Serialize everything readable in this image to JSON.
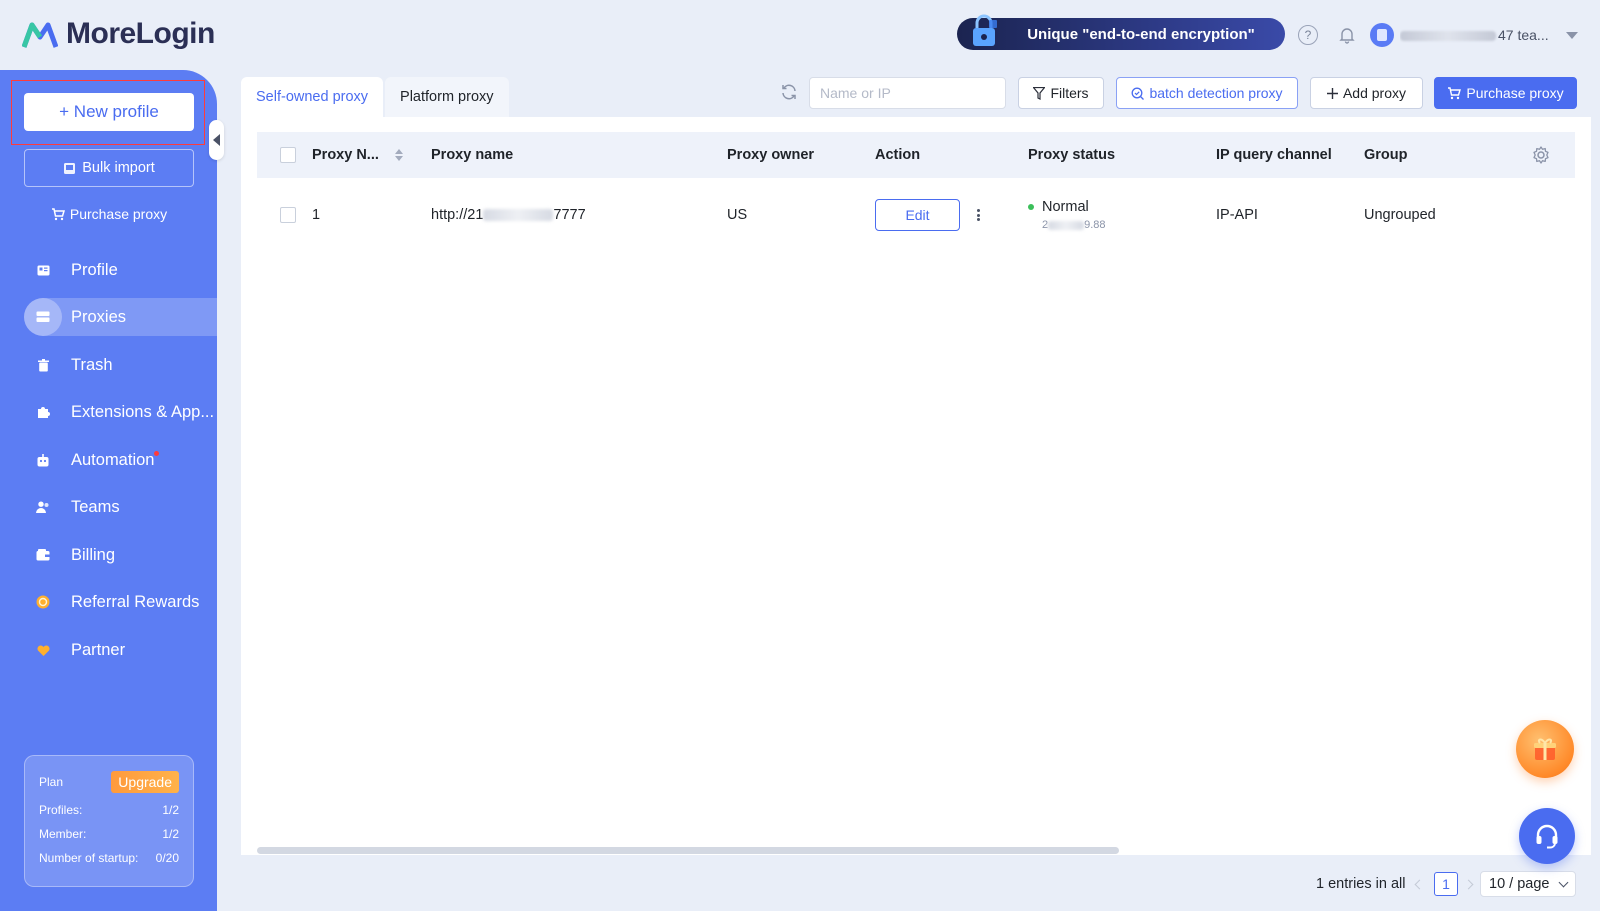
{
  "header": {
    "logo_text": "MoreLogin",
    "promo_text": "Unique \"end-to-end encryption\"",
    "account_suffix": "47 tea..."
  },
  "sidebar": {
    "new_profile_label": "+ New profile",
    "bulk_import_label": "Bulk import",
    "purchase_proxy_label": "Purchase proxy",
    "items": [
      {
        "label": "Profile",
        "icon": "profile-icon"
      },
      {
        "label": "Proxies",
        "icon": "proxies-icon",
        "active": true
      },
      {
        "label": "Trash",
        "icon": "trash-icon"
      },
      {
        "label": "Extensions & App...",
        "icon": "puzzle-icon"
      },
      {
        "label": "Automation",
        "icon": "robot-icon",
        "badge_dot": true
      },
      {
        "label": "Teams",
        "icon": "team-icon"
      },
      {
        "label": "Billing",
        "icon": "wallet-icon"
      },
      {
        "label": "Referral Rewards",
        "icon": "coin-icon"
      },
      {
        "label": "Partner",
        "icon": "heart-icon"
      }
    ],
    "plan": {
      "title": "Plan",
      "upgrade_label": "Upgrade",
      "rows": [
        {
          "label": "Profiles:",
          "value": "1/2"
        },
        {
          "label": "Member:",
          "value": "1/2"
        },
        {
          "label": "Number of startup:",
          "value": "0/20"
        }
      ]
    }
  },
  "toolbar": {
    "tabs": [
      {
        "label": "Self-owned proxy",
        "active": true
      },
      {
        "label": "Platform proxy",
        "active": false
      }
    ],
    "search_placeholder": "Name or IP",
    "filters_label": "Filters",
    "batch_label": "batch detection proxy",
    "add_label": "Add proxy",
    "purchase_label": "Purchase proxy"
  },
  "table": {
    "columns": [
      "Proxy N...",
      "Proxy name",
      "Proxy owner",
      "Action",
      "Proxy status",
      "IP query channel",
      "Group"
    ],
    "rows": [
      {
        "number": "1",
        "name_prefix": "http://21",
        "name_suffix": "7777",
        "owner": "US",
        "action": "Edit",
        "status": "Normal",
        "status_ip_prefix": "2",
        "status_ip_suffix": "9.88",
        "channel": "IP-API",
        "group": "Ungrouped"
      }
    ]
  },
  "pagination": {
    "total_text": "1 entries in all",
    "current_page": "1",
    "page_size": "10 / page"
  },
  "colors": {
    "accent": "#4a6cf0",
    "sidebar": "#5c7df3",
    "status_normal": "#3bbf5a",
    "upgrade": "#ff9a3c"
  }
}
